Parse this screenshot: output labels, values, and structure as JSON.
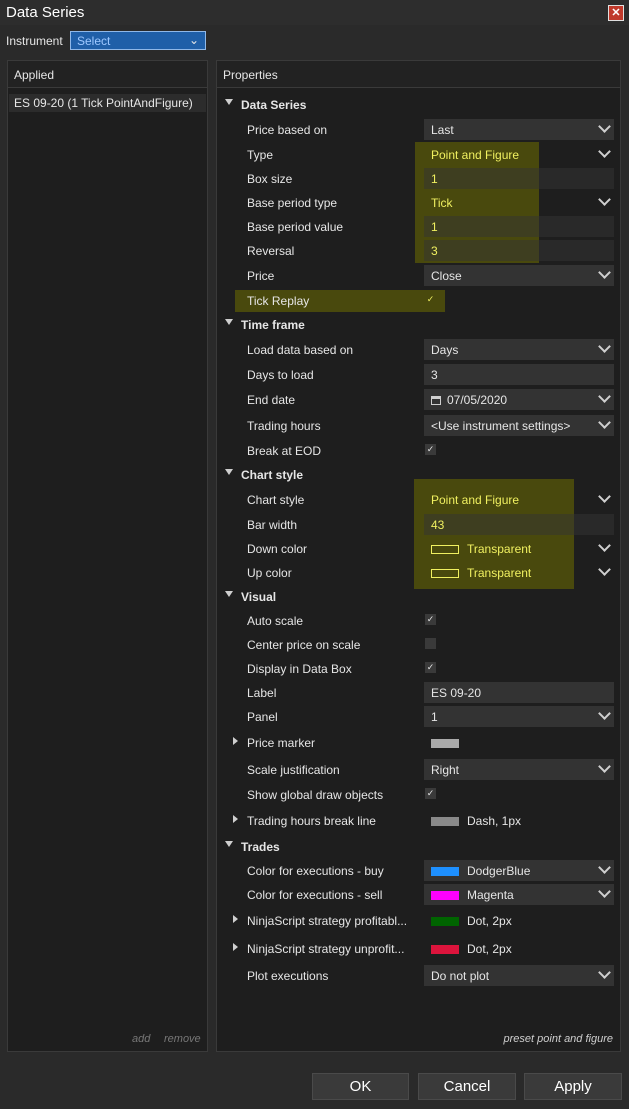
{
  "window": {
    "title": "Data Series",
    "close_glyph": "✕"
  },
  "instrument": {
    "label": "Instrument",
    "value": "Select"
  },
  "applied": {
    "header": "Applied",
    "item": "ES 09-20 (1 Tick PointAndFigure)",
    "add": "add",
    "remove": "remove"
  },
  "properties": {
    "header": "Properties",
    "preset_label": "preset point and figure"
  },
  "sections": {
    "data_series": {
      "title": "Data Series",
      "price_based_on": {
        "label": "Price based on",
        "value": "Last"
      },
      "type": {
        "label": "Type",
        "value": "Point and Figure"
      },
      "box_size": {
        "label": "Box size",
        "value": "1"
      },
      "base_period_type": {
        "label": "Base period type",
        "value": "Tick"
      },
      "base_period_value": {
        "label": "Base period value",
        "value": "1"
      },
      "reversal": {
        "label": "Reversal",
        "value": "3"
      },
      "price": {
        "label": "Price",
        "value": "Close"
      },
      "tick_replay": {
        "label": "Tick Replay",
        "checked": true
      }
    },
    "time_frame": {
      "title": "Time frame",
      "load_data_based_on": {
        "label": "Load data based on",
        "value": "Days"
      },
      "days_to_load": {
        "label": "Days to load",
        "value": "3"
      },
      "end_date": {
        "label": "End date",
        "value": "07/05/2020"
      },
      "trading_hours": {
        "label": "Trading hours",
        "value": "<Use instrument settings>"
      },
      "break_at_eod": {
        "label": "Break at EOD",
        "checked": true
      }
    },
    "chart_style": {
      "title": "Chart style",
      "chart_style": {
        "label": "Chart style",
        "value": "Point and Figure"
      },
      "bar_width": {
        "label": "Bar width",
        "value": "43"
      },
      "down_color": {
        "label": "Down color",
        "value": "Transparent"
      },
      "up_color": {
        "label": "Up color",
        "value": "Transparent"
      }
    },
    "visual": {
      "title": "Visual",
      "auto_scale": {
        "label": "Auto scale",
        "checked": true
      },
      "center_price": {
        "label": "Center price on scale",
        "checked": false
      },
      "display_data_box": {
        "label": "Display in Data Box",
        "checked": true
      },
      "label": {
        "label": "Label",
        "value": "ES 09-20"
      },
      "panel": {
        "label": "Panel",
        "value": "1"
      },
      "price_marker": {
        "label": "Price marker",
        "color": "#aaaaaa"
      },
      "scale_justification": {
        "label": "Scale justification",
        "value": "Right"
      },
      "show_global_draw": {
        "label": "Show global draw objects",
        "checked": true
      },
      "trading_hours_break": {
        "label": "Trading hours break line",
        "value": "Dash, 1px",
        "color": "#8a8a8a"
      }
    },
    "trades": {
      "title": "Trades",
      "exec_buy": {
        "label": "Color for executions - buy",
        "value": "DodgerBlue",
        "color": "#1e90ff"
      },
      "exec_sell": {
        "label": "Color for executions - sell",
        "value": "Magenta",
        "color": "#ff00ff"
      },
      "strat_profit": {
        "label": "NinjaScript strategy profitabl...",
        "value": "Dot, 2px",
        "color": "#006400"
      },
      "strat_unprofit": {
        "label": "NinjaScript strategy unprofit...",
        "value": "Dot, 2px",
        "color": "#dc143c"
      },
      "plot_exec": {
        "label": "Plot executions",
        "value": "Do not plot"
      }
    }
  },
  "buttons": {
    "ok": "OK",
    "cancel": "Cancel",
    "apply": "Apply"
  },
  "colors": {
    "highlight": "#6e6e00",
    "accent_text": "#f0f060",
    "select_blue": "#1f5fa8"
  }
}
